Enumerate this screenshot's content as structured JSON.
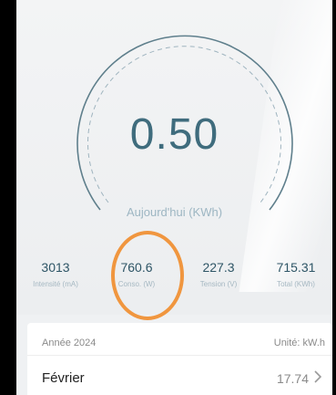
{
  "gauge": {
    "value": "0.50",
    "label": "Aujourd'hui (KWh)"
  },
  "stats": [
    {
      "value": "3013",
      "caption": "Intensité (mA)"
    },
    {
      "value": "760.6",
      "caption": "Conso. (W)"
    },
    {
      "value": "227.3",
      "caption": "Tension (V)"
    },
    {
      "value": "715.31",
      "caption": "Total (KWh)"
    }
  ],
  "card": {
    "year": "Année 2024",
    "unit": "Unité: kW.h",
    "month": "Février",
    "month_value": "17.74"
  },
  "colors": {
    "gauge_arc": "#5f7f8c",
    "value_text": "#3f6c7d",
    "highlight": "#f0963f"
  },
  "icons": {
    "chevron": "chevron-right-icon"
  }
}
